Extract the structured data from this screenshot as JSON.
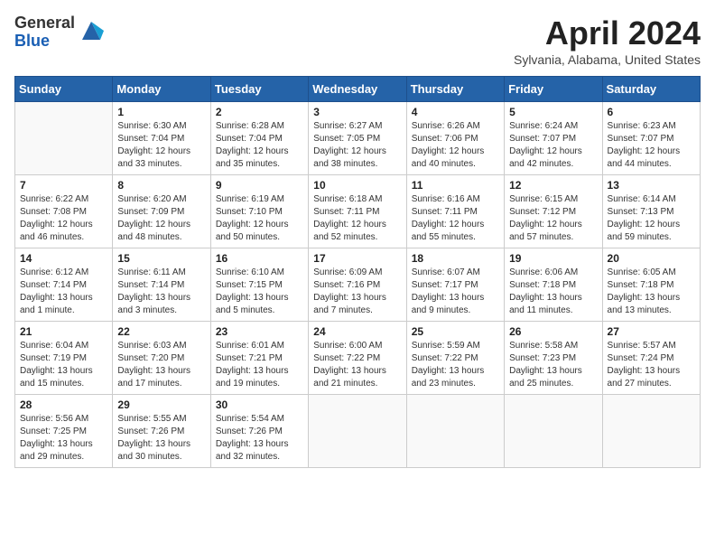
{
  "header": {
    "logo_general": "General",
    "logo_blue": "Blue",
    "month_title": "April 2024",
    "location": "Sylvania, Alabama, United States"
  },
  "weekdays": [
    "Sunday",
    "Monday",
    "Tuesday",
    "Wednesday",
    "Thursday",
    "Friday",
    "Saturday"
  ],
  "weeks": [
    [
      {
        "day": "",
        "sunrise": "",
        "sunset": "",
        "daylight": ""
      },
      {
        "day": "1",
        "sunrise": "Sunrise: 6:30 AM",
        "sunset": "Sunset: 7:04 PM",
        "daylight": "Daylight: 12 hours and 33 minutes."
      },
      {
        "day": "2",
        "sunrise": "Sunrise: 6:28 AM",
        "sunset": "Sunset: 7:04 PM",
        "daylight": "Daylight: 12 hours and 35 minutes."
      },
      {
        "day": "3",
        "sunrise": "Sunrise: 6:27 AM",
        "sunset": "Sunset: 7:05 PM",
        "daylight": "Daylight: 12 hours and 38 minutes."
      },
      {
        "day": "4",
        "sunrise": "Sunrise: 6:26 AM",
        "sunset": "Sunset: 7:06 PM",
        "daylight": "Daylight: 12 hours and 40 minutes."
      },
      {
        "day": "5",
        "sunrise": "Sunrise: 6:24 AM",
        "sunset": "Sunset: 7:07 PM",
        "daylight": "Daylight: 12 hours and 42 minutes."
      },
      {
        "day": "6",
        "sunrise": "Sunrise: 6:23 AM",
        "sunset": "Sunset: 7:07 PM",
        "daylight": "Daylight: 12 hours and 44 minutes."
      }
    ],
    [
      {
        "day": "7",
        "sunrise": "Sunrise: 6:22 AM",
        "sunset": "Sunset: 7:08 PM",
        "daylight": "Daylight: 12 hours and 46 minutes."
      },
      {
        "day": "8",
        "sunrise": "Sunrise: 6:20 AM",
        "sunset": "Sunset: 7:09 PM",
        "daylight": "Daylight: 12 hours and 48 minutes."
      },
      {
        "day": "9",
        "sunrise": "Sunrise: 6:19 AM",
        "sunset": "Sunset: 7:10 PM",
        "daylight": "Daylight: 12 hours and 50 minutes."
      },
      {
        "day": "10",
        "sunrise": "Sunrise: 6:18 AM",
        "sunset": "Sunset: 7:11 PM",
        "daylight": "Daylight: 12 hours and 52 minutes."
      },
      {
        "day": "11",
        "sunrise": "Sunrise: 6:16 AM",
        "sunset": "Sunset: 7:11 PM",
        "daylight": "Daylight: 12 hours and 55 minutes."
      },
      {
        "day": "12",
        "sunrise": "Sunrise: 6:15 AM",
        "sunset": "Sunset: 7:12 PM",
        "daylight": "Daylight: 12 hours and 57 minutes."
      },
      {
        "day": "13",
        "sunrise": "Sunrise: 6:14 AM",
        "sunset": "Sunset: 7:13 PM",
        "daylight": "Daylight: 12 hours and 59 minutes."
      }
    ],
    [
      {
        "day": "14",
        "sunrise": "Sunrise: 6:12 AM",
        "sunset": "Sunset: 7:14 PM",
        "daylight": "Daylight: 13 hours and 1 minute."
      },
      {
        "day": "15",
        "sunrise": "Sunrise: 6:11 AM",
        "sunset": "Sunset: 7:14 PM",
        "daylight": "Daylight: 13 hours and 3 minutes."
      },
      {
        "day": "16",
        "sunrise": "Sunrise: 6:10 AM",
        "sunset": "Sunset: 7:15 PM",
        "daylight": "Daylight: 13 hours and 5 minutes."
      },
      {
        "day": "17",
        "sunrise": "Sunrise: 6:09 AM",
        "sunset": "Sunset: 7:16 PM",
        "daylight": "Daylight: 13 hours and 7 minutes."
      },
      {
        "day": "18",
        "sunrise": "Sunrise: 6:07 AM",
        "sunset": "Sunset: 7:17 PM",
        "daylight": "Daylight: 13 hours and 9 minutes."
      },
      {
        "day": "19",
        "sunrise": "Sunrise: 6:06 AM",
        "sunset": "Sunset: 7:18 PM",
        "daylight": "Daylight: 13 hours and 11 minutes."
      },
      {
        "day": "20",
        "sunrise": "Sunrise: 6:05 AM",
        "sunset": "Sunset: 7:18 PM",
        "daylight": "Daylight: 13 hours and 13 minutes."
      }
    ],
    [
      {
        "day": "21",
        "sunrise": "Sunrise: 6:04 AM",
        "sunset": "Sunset: 7:19 PM",
        "daylight": "Daylight: 13 hours and 15 minutes."
      },
      {
        "day": "22",
        "sunrise": "Sunrise: 6:03 AM",
        "sunset": "Sunset: 7:20 PM",
        "daylight": "Daylight: 13 hours and 17 minutes."
      },
      {
        "day": "23",
        "sunrise": "Sunrise: 6:01 AM",
        "sunset": "Sunset: 7:21 PM",
        "daylight": "Daylight: 13 hours and 19 minutes."
      },
      {
        "day": "24",
        "sunrise": "Sunrise: 6:00 AM",
        "sunset": "Sunset: 7:22 PM",
        "daylight": "Daylight: 13 hours and 21 minutes."
      },
      {
        "day": "25",
        "sunrise": "Sunrise: 5:59 AM",
        "sunset": "Sunset: 7:22 PM",
        "daylight": "Daylight: 13 hours and 23 minutes."
      },
      {
        "day": "26",
        "sunrise": "Sunrise: 5:58 AM",
        "sunset": "Sunset: 7:23 PM",
        "daylight": "Daylight: 13 hours and 25 minutes."
      },
      {
        "day": "27",
        "sunrise": "Sunrise: 5:57 AM",
        "sunset": "Sunset: 7:24 PM",
        "daylight": "Daylight: 13 hours and 27 minutes."
      }
    ],
    [
      {
        "day": "28",
        "sunrise": "Sunrise: 5:56 AM",
        "sunset": "Sunset: 7:25 PM",
        "daylight": "Daylight: 13 hours and 29 minutes."
      },
      {
        "day": "29",
        "sunrise": "Sunrise: 5:55 AM",
        "sunset": "Sunset: 7:26 PM",
        "daylight": "Daylight: 13 hours and 30 minutes."
      },
      {
        "day": "30",
        "sunrise": "Sunrise: 5:54 AM",
        "sunset": "Sunset: 7:26 PM",
        "daylight": "Daylight: 13 hours and 32 minutes."
      },
      {
        "day": "",
        "sunrise": "",
        "sunset": "",
        "daylight": ""
      },
      {
        "day": "",
        "sunrise": "",
        "sunset": "",
        "daylight": ""
      },
      {
        "day": "",
        "sunrise": "",
        "sunset": "",
        "daylight": ""
      },
      {
        "day": "",
        "sunrise": "",
        "sunset": "",
        "daylight": ""
      }
    ]
  ]
}
